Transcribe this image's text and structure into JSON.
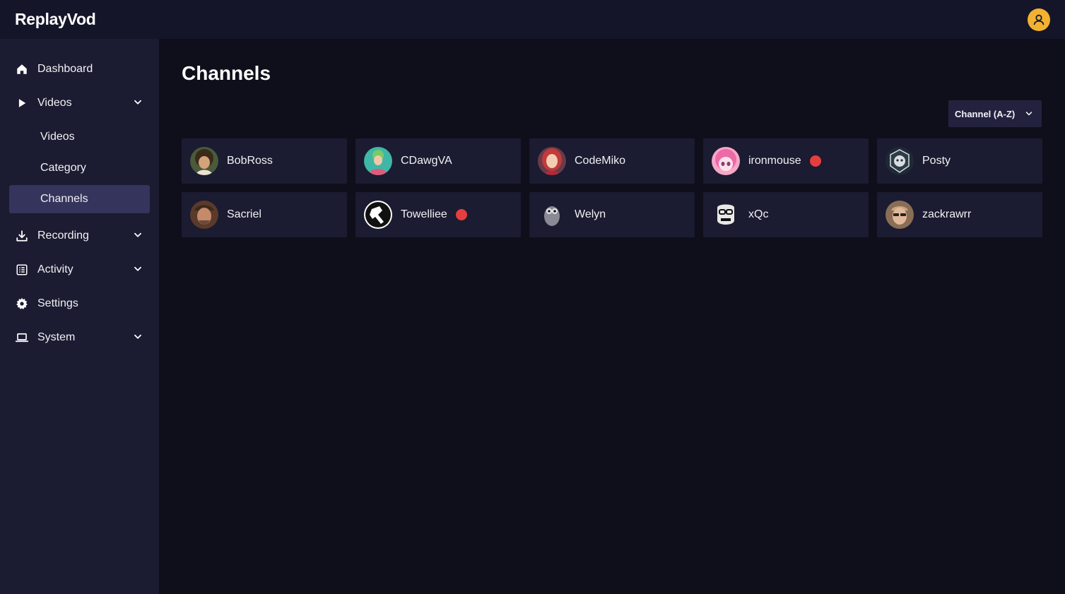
{
  "app": {
    "title": "ReplayVod"
  },
  "header": {
    "user_icon": "user-icon",
    "user_color": "#f2b230"
  },
  "sidebar": {
    "items": [
      {
        "label": "Dashboard",
        "icon": "home-icon"
      },
      {
        "label": "Videos",
        "icon": "play-icon",
        "expandable": true,
        "expanded": true,
        "children": [
          {
            "label": "Videos",
            "active": false
          },
          {
            "label": "Category",
            "active": false
          },
          {
            "label": "Channels",
            "active": true
          }
        ]
      },
      {
        "label": "Recording",
        "icon": "download-icon",
        "expandable": true
      },
      {
        "label": "Activity",
        "icon": "list-icon",
        "expandable": true
      },
      {
        "label": "Settings",
        "icon": "gear-icon"
      },
      {
        "label": "System",
        "icon": "laptop-icon",
        "expandable": true
      }
    ]
  },
  "main": {
    "title": "Channels",
    "sort": {
      "selected": "Channel (A-Z)"
    },
    "channels": [
      {
        "name": "BobRoss",
        "live": false,
        "avatar_bg": "#5b4a2e",
        "avatar_fg": "#c89b6d"
      },
      {
        "name": "CDawgVA",
        "live": false,
        "avatar_bg": "#3fb7a7",
        "avatar_fg": "#e05a7a"
      },
      {
        "name": "CodeMiko",
        "live": false,
        "avatar_bg": "#7a3a5a",
        "avatar_fg": "#c23a3a"
      },
      {
        "name": "ironmouse",
        "live": true,
        "avatar_bg": "#f6a7c8",
        "avatar_fg": "#ec6aa8"
      },
      {
        "name": "Posty",
        "live": false,
        "avatar_bg": "#1e2a35",
        "avatar_fg": "#d8dde2"
      },
      {
        "name": "Sacriel",
        "live": false,
        "avatar_bg": "#5a3a2a",
        "avatar_fg": "#b57a5a"
      },
      {
        "name": "Towelliee",
        "live": true,
        "avatar_bg": "#ffffff",
        "avatar_fg": "#111111"
      },
      {
        "name": "Welyn",
        "live": false,
        "avatar_bg": "#1b1b31",
        "avatar_fg": "#8a8a96"
      },
      {
        "name": "xQc",
        "live": false,
        "avatar_bg": "#1b1b31",
        "avatar_fg": "#e8e8e8"
      },
      {
        "name": "zackrawrr",
        "live": false,
        "avatar_bg": "#8a6d55",
        "avatar_fg": "#d9b08c"
      }
    ]
  },
  "colors": {
    "live": "#e53e3e",
    "active_nav": "#35345c"
  }
}
